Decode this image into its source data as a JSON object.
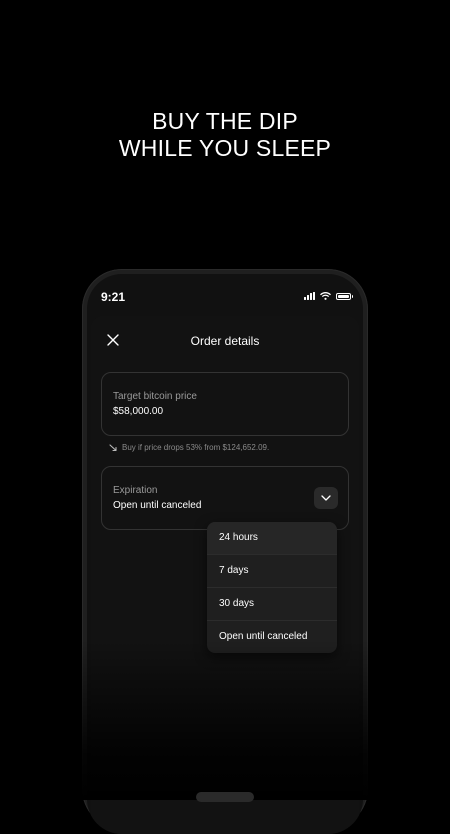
{
  "headline": {
    "line1": "BUY THE DIP",
    "line2": "WHILE YOU SLEEP"
  },
  "status_bar": {
    "time": "9:21"
  },
  "sheet": {
    "title": "Order details",
    "target_price": {
      "label": "Target bitcoin price",
      "value": "$58,000.00"
    },
    "hint": "Buy if price drops 53% from $124,652.09.",
    "expiration": {
      "label": "Expiration",
      "value": "Open until canceled"
    }
  },
  "dropdown": {
    "options": [
      "24 hours",
      "7 days",
      "30 days",
      "Open until canceled"
    ]
  },
  "colors": {
    "background": "#000000",
    "surface": "#121212",
    "border": "#333333",
    "muted_text": "#9a9a9a"
  },
  "icons": {
    "close": "close-icon",
    "chevron": "chevron-down-icon",
    "hint": "trend-down-arrow-icon"
  }
}
